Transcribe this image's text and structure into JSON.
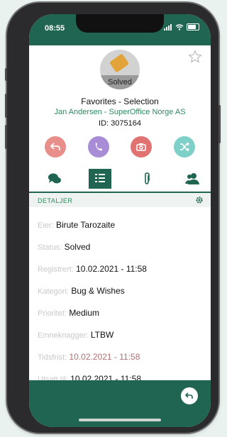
{
  "status_bar": {
    "time": "08:55"
  },
  "ticket": {
    "badge": "Solved",
    "title": "Favorites - Selection",
    "contact": "Jan Andersen -  SuperOffice Norge AS",
    "id": "ID: 3075164"
  },
  "actions": [
    {
      "icon": "reply-icon",
      "color": "#e98f8b"
    },
    {
      "icon": "phone-icon",
      "color": "#a98cd6"
    },
    {
      "icon": "camera-icon",
      "color": "#e07272"
    },
    {
      "icon": "shuffle-icon",
      "color": "#7ed0c8"
    }
  ],
  "tabs": [
    {
      "icon": "chat-icon"
    },
    {
      "icon": "details-list-icon"
    },
    {
      "icon": "paperclip-icon"
    },
    {
      "icon": "people-icon"
    }
  ],
  "section": {
    "label": "DETALJER"
  },
  "details": [
    {
      "label": "Eier:",
      "value": "Birute Tarozaite"
    },
    {
      "label": "Status:",
      "value": "Solved"
    },
    {
      "label": "Registrert:",
      "value": "10.02.2021 - 11:58"
    },
    {
      "label": "Kategori:",
      "value": "Bug & Wishes"
    },
    {
      "label": "Prioritet:",
      "value": "Medium"
    },
    {
      "label": "Emneknagger:",
      "value": "LTBW"
    },
    {
      "label": "Tidsfrist:",
      "value": "10.02.2021 - 11:58"
    },
    {
      "label": "Utsatt til:",
      "value": "10.02.2021 - 11:58"
    }
  ],
  "colors": {
    "accent": "#1f6552",
    "link_green": "#2a8a5e",
    "deadline_red": "#b07070"
  }
}
